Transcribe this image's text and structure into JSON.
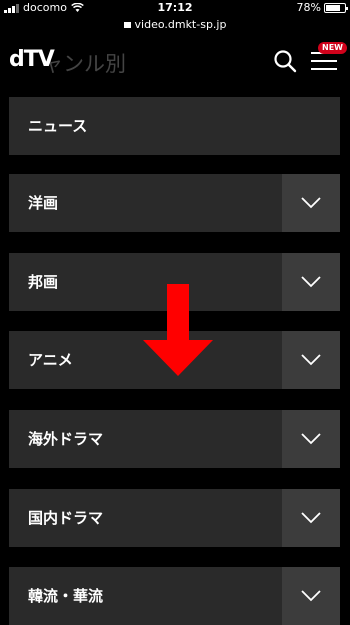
{
  "status_bar": {
    "carrier": "docomo",
    "time": "17:12",
    "battery": "78%",
    "battery_level": 0.78
  },
  "url_bar": {
    "url": "video.dmkt-sp.jp"
  },
  "header": {
    "logo": "dTV",
    "title": "ャンル別",
    "new_badge": "NEW"
  },
  "menu": {
    "items": [
      {
        "label": "ニュース",
        "expandable": false
      },
      {
        "label": "洋画",
        "expandable": true
      },
      {
        "label": "邦画",
        "expandable": true
      },
      {
        "label": "アニメ",
        "expandable": true
      },
      {
        "label": "海外ドラマ",
        "expandable": true
      },
      {
        "label": "国内ドラマ",
        "expandable": true
      },
      {
        "label": "韓流・華流",
        "expandable": true
      }
    ]
  },
  "colors": {
    "background": "#000000",
    "item_background": "#2a2a2a",
    "chevron_background": "#3c3c3c",
    "badge": "#d0021b",
    "overlay_arrow": "#ff0000"
  }
}
